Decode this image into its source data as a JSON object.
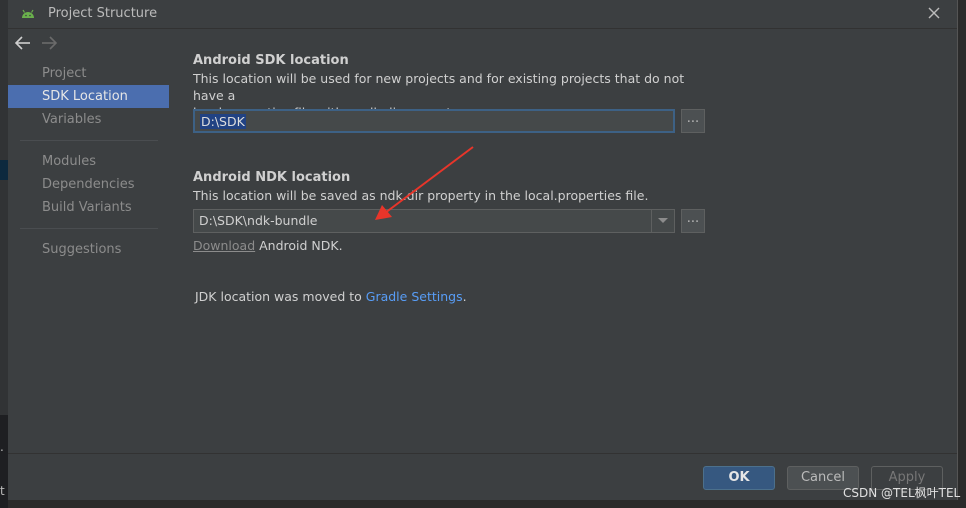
{
  "window": {
    "title": "Project Structure",
    "icon": "android-icon"
  },
  "sidebar": {
    "items": [
      {
        "label": "Project",
        "selected": false
      },
      {
        "label": "SDK Location",
        "selected": true
      },
      {
        "label": "Variables",
        "selected": false
      },
      {
        "label": "Modules",
        "selected": false
      },
      {
        "label": "Dependencies",
        "selected": false
      },
      {
        "label": "Build Variants",
        "selected": false
      },
      {
        "label": "Suggestions",
        "selected": false
      }
    ]
  },
  "sdk": {
    "title": "Android SDK location",
    "description_line1": "This location will be used for new projects and for existing projects that do not have a",
    "description_line2": "local.properties file with a sdk.dir property.",
    "value": "D:\\SDK",
    "browse_label": "..."
  },
  "ndk": {
    "title": "Android NDK location",
    "description": "This location will be saved as ndk.dir property in the local.properties file.",
    "value": "D:\\SDK\\ndk-bundle",
    "browse_label": "...",
    "download_link": "Download",
    "download_suffix": " Android NDK."
  },
  "jdk": {
    "text": "JDK location was moved to ",
    "link": "Gradle Settings",
    "suffix": "."
  },
  "footer": {
    "ok": "OK",
    "cancel": "Cancel",
    "apply": "Apply"
  },
  "background": {
    "glyph1": ".",
    "glyph2": "t"
  },
  "watermark": "CSDN @TEL枫叶TEL",
  "colors": {
    "selection": "#4b6eaf",
    "link": "#589df6",
    "annotation_arrow": "#e8352a"
  }
}
